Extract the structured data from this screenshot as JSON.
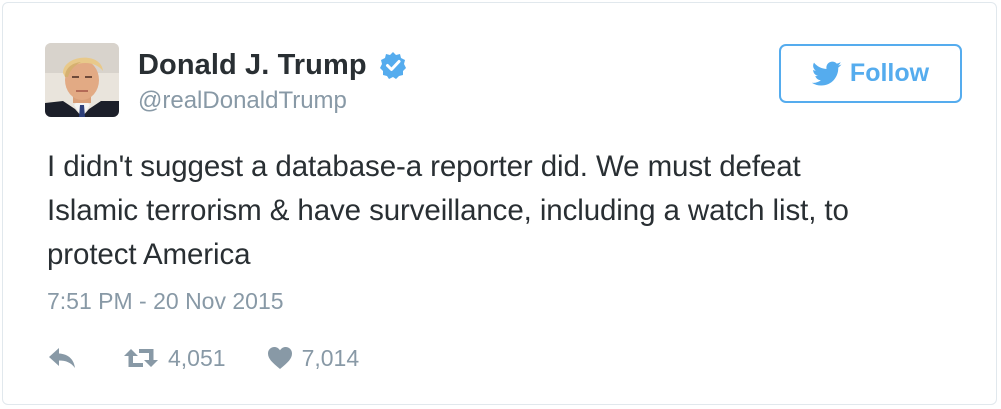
{
  "colors": {
    "accent": "#55acee",
    "text": "#292f33",
    "muted": "#8899a6",
    "border": "#e1e8ed"
  },
  "user": {
    "display_name": "Donald J. Trump",
    "handle": "@realDonaldTrump",
    "verified": true,
    "avatar_icon": "profile-photo",
    "verified_icon": "verified-badge-icon"
  },
  "follow_button": {
    "label": "Follow",
    "icon": "twitter-bird-icon"
  },
  "tweet": {
    "text_lines": [
      "I didn't suggest a database-a reporter did. We must defeat",
      "Islamic terrorism & have surveillance, including a watch list, to",
      "protect America"
    ],
    "timestamp": "7:51 PM - 20 Nov 2015"
  },
  "actions": {
    "reply_icon": "reply-icon",
    "retweet_icon": "retweet-icon",
    "retweet_count": "4,051",
    "like_icon": "heart-icon",
    "like_count": "7,014"
  }
}
